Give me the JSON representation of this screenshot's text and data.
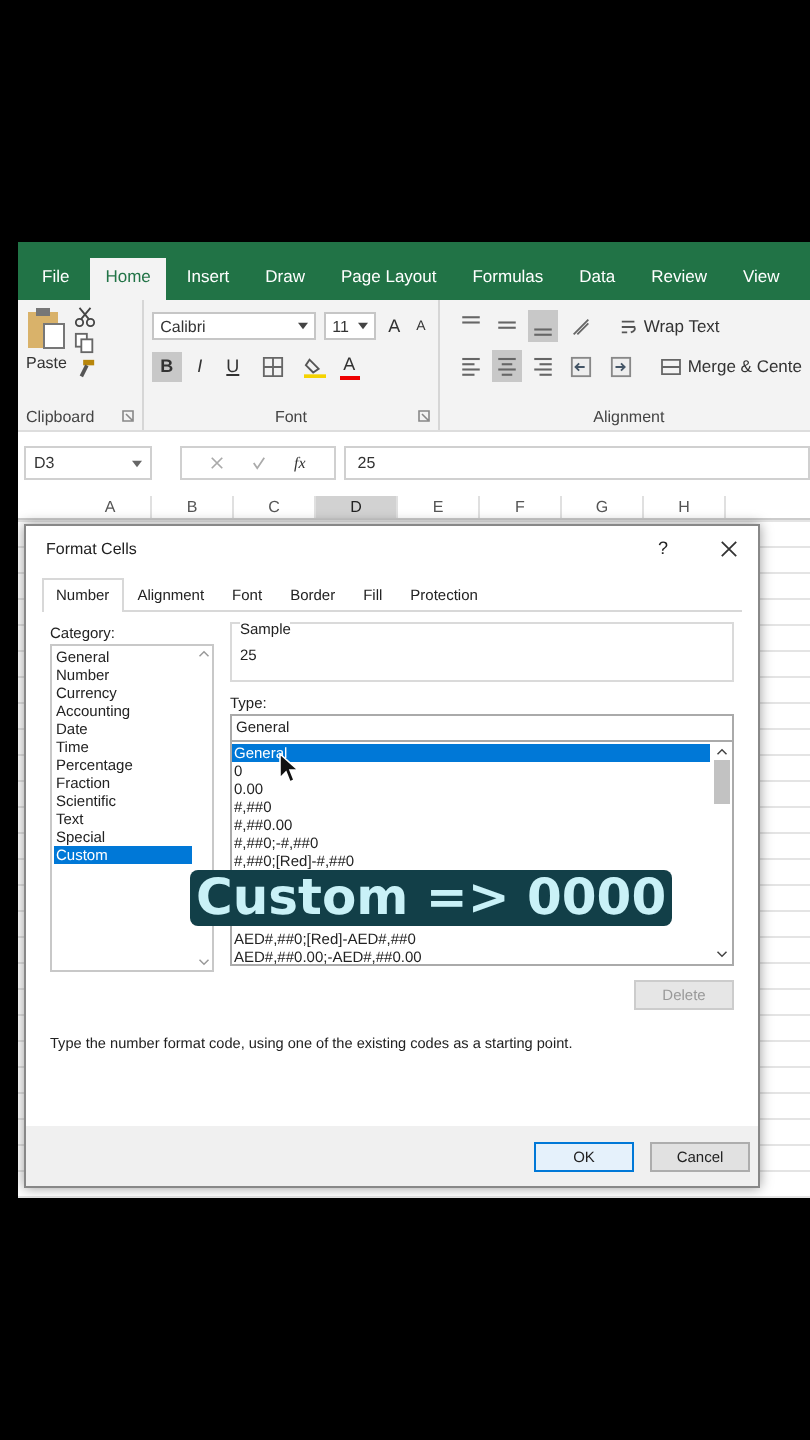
{
  "ribbon_tabs": [
    {
      "label": "File",
      "selected": false
    },
    {
      "label": "Home",
      "selected": true
    },
    {
      "label": "Insert",
      "selected": false
    },
    {
      "label": "Draw",
      "selected": false
    },
    {
      "label": "Page Layout",
      "selected": false
    },
    {
      "label": "Formulas",
      "selected": false
    },
    {
      "label": "Data",
      "selected": false
    },
    {
      "label": "Review",
      "selected": false
    },
    {
      "label": "View",
      "selected": false
    }
  ],
  "clipboard": {
    "paste": "Paste",
    "group_label": "Clipboard"
  },
  "font_group": {
    "font": "Calibri",
    "size": "11",
    "grow": "A",
    "shrink": "A",
    "font_color": "A",
    "group_label": "Font",
    "style_buttons": [
      {
        "label": "B",
        "kind": "bold",
        "pressed": true
      },
      {
        "label": "I",
        "kind": "italic",
        "pressed": false
      },
      {
        "label": "U",
        "kind": "underline",
        "pressed": false
      }
    ]
  },
  "alignment_group": {
    "group_label": "Alignment",
    "wrap_text": "Wrap Text",
    "merge": "Merge & Cente",
    "vertical": [
      {
        "kind": "top",
        "selected": false
      },
      {
        "kind": "middle",
        "selected": false
      },
      {
        "kind": "bottom",
        "selected": true
      }
    ],
    "horizontal": [
      {
        "kind": "left",
        "selected": false
      },
      {
        "kind": "center",
        "selected": true
      },
      {
        "kind": "right",
        "selected": false
      }
    ]
  },
  "formula_bar": {
    "name_box": "D3",
    "fx": "fx",
    "value": "25"
  },
  "columns": [
    {
      "label": "A",
      "selected": false
    },
    {
      "label": "B",
      "selected": false
    },
    {
      "label": "C",
      "selected": false
    },
    {
      "label": "D",
      "selected": true
    },
    {
      "label": "E",
      "selected": false
    },
    {
      "label": "F",
      "selected": false
    },
    {
      "label": "G",
      "selected": false
    },
    {
      "label": "H",
      "selected": false
    }
  ],
  "dialog": {
    "title": "Format Cells",
    "help": "?",
    "tabs": [
      {
        "label": "Number",
        "selected": true
      },
      {
        "label": "Alignment",
        "selected": false
      },
      {
        "label": "Font",
        "selected": false
      },
      {
        "label": "Border",
        "selected": false
      },
      {
        "label": "Fill",
        "selected": false
      },
      {
        "label": "Protection",
        "selected": false
      }
    ],
    "category_label": "Category:",
    "categories": [
      {
        "label": "General",
        "selected": false
      },
      {
        "label": "Number",
        "selected": false
      },
      {
        "label": "Currency",
        "selected": false
      },
      {
        "label": "Accounting",
        "selected": false
      },
      {
        "label": "Date",
        "selected": false
      },
      {
        "label": "Time",
        "selected": false
      },
      {
        "label": "Percentage",
        "selected": false
      },
      {
        "label": "Fraction",
        "selected": false
      },
      {
        "label": "Scientific",
        "selected": false
      },
      {
        "label": "Text",
        "selected": false
      },
      {
        "label": "Special",
        "selected": false
      },
      {
        "label": "Custom",
        "selected": true
      }
    ],
    "sample_label": "Sample",
    "sample_value": "25",
    "type_label": "Type:",
    "type_value": "General",
    "type_options": [
      {
        "label": "General",
        "selected": true
      },
      {
        "label": "0",
        "selected": false
      },
      {
        "label": "0.00",
        "selected": false
      },
      {
        "label": "#,##0",
        "selected": false
      },
      {
        "label": "#,##0.00",
        "selected": false
      },
      {
        "label": "#,##0;-#,##0",
        "selected": false
      },
      {
        "label": "#,##0;[Red]-#,##0",
        "selected": false
      }
    ],
    "type_options_below_caption": [
      {
        "label": "AED#,##0;[Red]-AED#,##0",
        "selected": false
      },
      {
        "label": "AED#,##0.00;-AED#,##0.00",
        "selected": false
      }
    ],
    "delete_button": {
      "label": "Delete",
      "disabled": true
    },
    "description": "Type the number format code, using one of the existing codes as a starting point.",
    "buttons": [
      {
        "label": "OK",
        "kind": "default"
      },
      {
        "label": "Cancel",
        "kind": "normal"
      }
    ]
  },
  "caption": "Custom => 0000"
}
